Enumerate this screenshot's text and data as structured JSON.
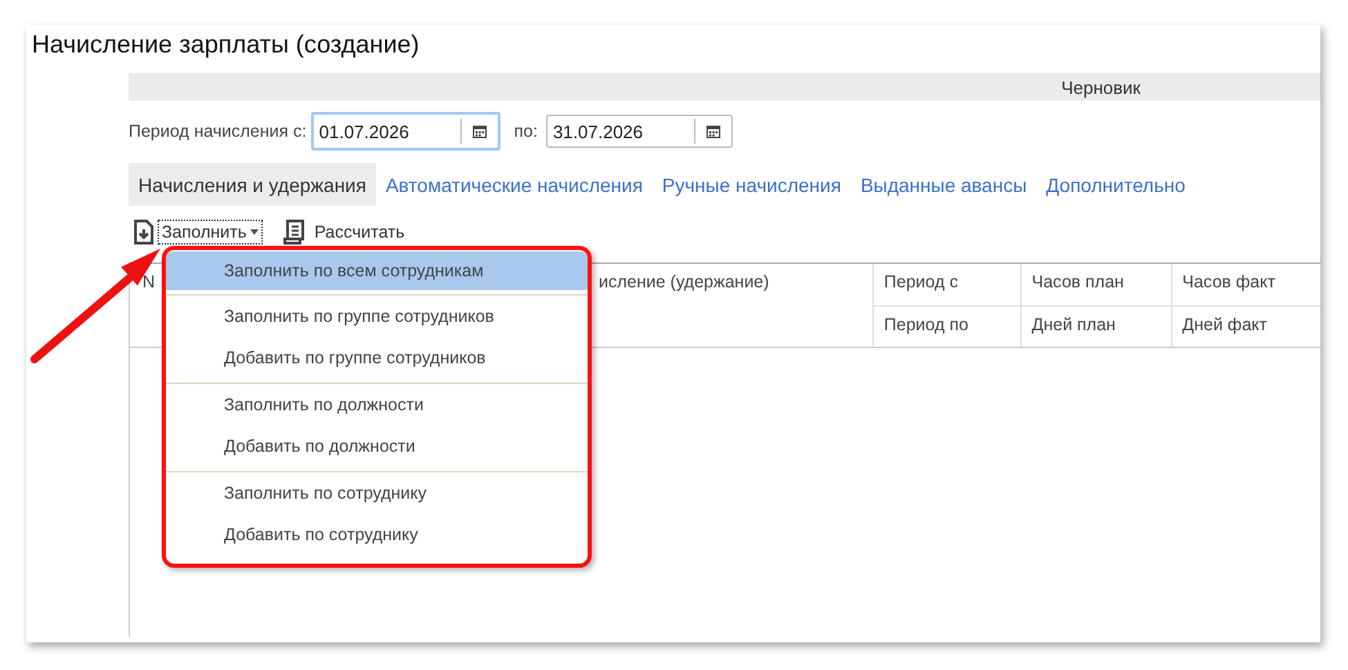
{
  "window": {
    "title": "Начисление зарплаты (создание)"
  },
  "status": "Черновик",
  "period": {
    "from_label": "Период начисления с:",
    "from": {
      "value": "01.07.2026",
      "focused": true
    },
    "to_label": "по:",
    "to": {
      "value": "31.07.2026",
      "focused": false
    }
  },
  "tabs": [
    {
      "label": "Начисления и удержания",
      "selected": true
    },
    {
      "label": "Автоматические начисления",
      "selected": false
    },
    {
      "label": "Ручные начисления",
      "selected": false
    },
    {
      "label": "Выданные авансы",
      "selected": false
    },
    {
      "label": "Дополнительно",
      "selected": false
    }
  ],
  "toolbar": [
    {
      "label": "Заполнить",
      "kind": "dropdown"
    },
    {
      "label": "Рассчитать",
      "kind": "button"
    }
  ],
  "table": {
    "columns": [
      {
        "headers": [
          "N"
        ]
      },
      {
        "headers": [
          "исление (удержание)"
        ]
      },
      {
        "headers": [
          "Период с",
          "Период по"
        ]
      },
      {
        "headers": [
          "Часов план",
          "Дней план"
        ]
      },
      {
        "headers": [
          "Часов факт",
          "Дней факт"
        ]
      }
    ]
  },
  "menu": {
    "items": [
      {
        "label": "Заполнить по всем сотрудникам",
        "selected": true,
        "separator_before": false
      },
      {
        "label": "Заполнить по группе сотрудников",
        "selected": false,
        "separator_before": true
      },
      {
        "label": "Добавить по группе сотрудников",
        "selected": false,
        "separator_before": false
      },
      {
        "label": "Заполнить по должности",
        "selected": false,
        "separator_before": true
      },
      {
        "label": "Добавить по должности",
        "selected": false,
        "separator_before": false
      },
      {
        "label": "Заполнить по сотруднику",
        "selected": false,
        "separator_before": true
      },
      {
        "label": "Добавить по сотруднику",
        "selected": false,
        "separator_before": false
      }
    ]
  }
}
